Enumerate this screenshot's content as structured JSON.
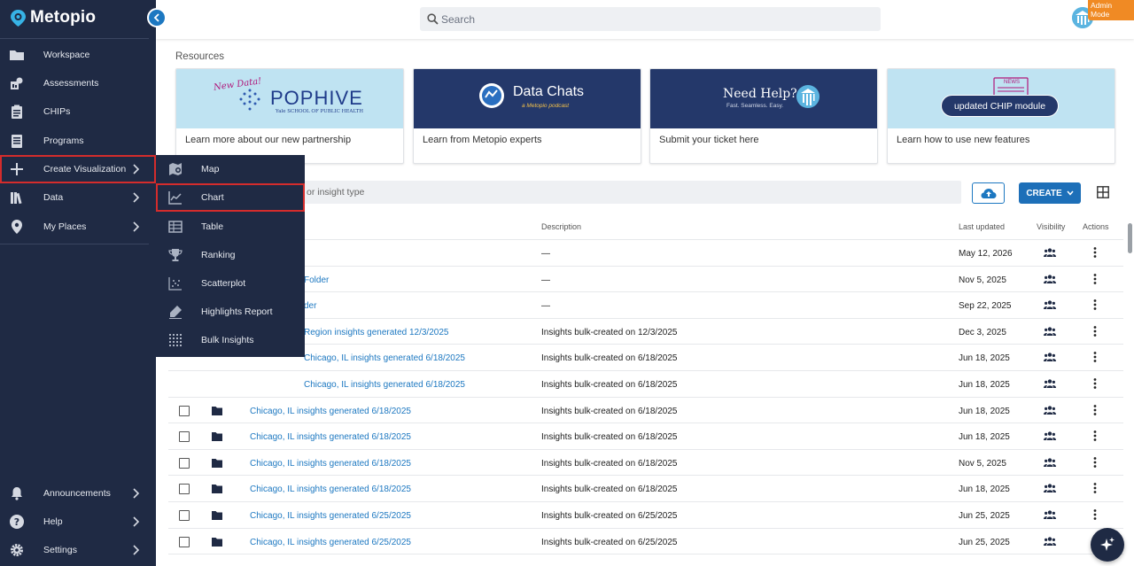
{
  "app": {
    "name": "Metopio",
    "admin_badge": "Admin Mode"
  },
  "search": {
    "placeholder": "Search"
  },
  "sidebar": {
    "items": [
      {
        "label": "Workspace",
        "icon": "folder-icon"
      },
      {
        "label": "Assessments",
        "icon": "assessment-icon"
      },
      {
        "label": "CHIPs",
        "icon": "clipboard-icon"
      },
      {
        "label": "Programs",
        "icon": "document-icon"
      },
      {
        "label": "Create Visualization",
        "icon": "plus-icon"
      },
      {
        "label": "Data",
        "icon": "books-icon"
      },
      {
        "label": "My Places",
        "icon": "location-pin-icon"
      }
    ],
    "bottom_items": [
      {
        "label": "Announcements",
        "icon": "bell-icon"
      },
      {
        "label": "Help",
        "icon": "help-icon"
      },
      {
        "label": "Settings",
        "icon": "gear-icon"
      }
    ]
  },
  "flyout": {
    "items": [
      {
        "label": "Map",
        "icon": "map-icon"
      },
      {
        "label": "Chart",
        "icon": "line-chart-icon"
      },
      {
        "label": "Table",
        "icon": "table-icon"
      },
      {
        "label": "Ranking",
        "icon": "trophy-icon"
      },
      {
        "label": "Scatterplot",
        "icon": "scatterplot-icon"
      },
      {
        "label": "Highlights Report",
        "icon": "highlighter-icon"
      },
      {
        "label": "Bulk Insights",
        "icon": "grid-dots-icon"
      }
    ]
  },
  "resources": {
    "title": "Resources",
    "cards": [
      {
        "caption": "Learn more about our new partnership",
        "banner_title": "POPHIVE",
        "banner_tag": "New Data!",
        "banner_sub": "Yale SCHOOL OF PUBLIC HEALTH"
      },
      {
        "caption": "Learn from Metopio experts",
        "banner_title": "Data Chats",
        "banner_sub": "a Metopio podcast"
      },
      {
        "caption": "Submit your ticket here",
        "banner_title": "Need Help?",
        "banner_sub": "Fast. Seamless. Easy."
      },
      {
        "caption": "Learn how to use new features",
        "banner_title": "updated CHIP module",
        "banner_tag": "NEWS"
      }
    ]
  },
  "toolbar": {
    "filter_placeholder": "or insight type",
    "create_label": "CREATE"
  },
  "table": {
    "columns": {
      "description": "Description",
      "last_updated": "Last updated",
      "visibility": "Visibility",
      "actions": "Actions"
    },
    "rows": [
      {
        "name": "",
        "description": "—",
        "date": "May 12, 2026"
      },
      {
        "name": "Folder",
        "description": "—",
        "date": "Nov 5, 2025"
      },
      {
        "name": "der",
        "description": "—",
        "date": "Sep 22, 2025"
      },
      {
        "name": "Region insights generated 12/3/2025",
        "description": "Insights bulk-created on 12/3/2025",
        "date": "Dec 3, 2025"
      },
      {
        "name": "Chicago, IL insights generated 6/18/2025",
        "description": "Insights bulk-created on 6/18/2025",
        "date": "Jun 18, 2025"
      },
      {
        "name": "Chicago, IL insights generated 6/18/2025",
        "description": "Insights bulk-created on 6/18/2025",
        "date": "Jun 18, 2025"
      },
      {
        "name": "Chicago, IL insights generated 6/18/2025",
        "description": "Insights bulk-created on 6/18/2025",
        "date": "Jun 18, 2025"
      },
      {
        "name": "Chicago, IL insights generated 6/18/2025",
        "description": "Insights bulk-created on 6/18/2025",
        "date": "Jun 18, 2025"
      },
      {
        "name": "Chicago, IL insights generated 6/18/2025",
        "description": "Insights bulk-created on 6/18/2025",
        "date": "Nov 5, 2025"
      },
      {
        "name": "Chicago, IL insights generated 6/18/2025",
        "description": "Insights bulk-created on 6/18/2025",
        "date": "Jun 18, 2025"
      },
      {
        "name": "Chicago, IL insights generated 6/25/2025",
        "description": "Insights bulk-created on 6/25/2025",
        "date": "Jun 25, 2025"
      },
      {
        "name": "Chicago, IL insights generated 6/25/2025",
        "description": "Insights bulk-created on 6/25/2025",
        "date": "Jun 25, 2025"
      }
    ]
  },
  "colors": {
    "sidebar": "#1f2a44",
    "accent": "#1d78c1",
    "highlight": "#d42c2c",
    "admin": "#f08a24"
  }
}
